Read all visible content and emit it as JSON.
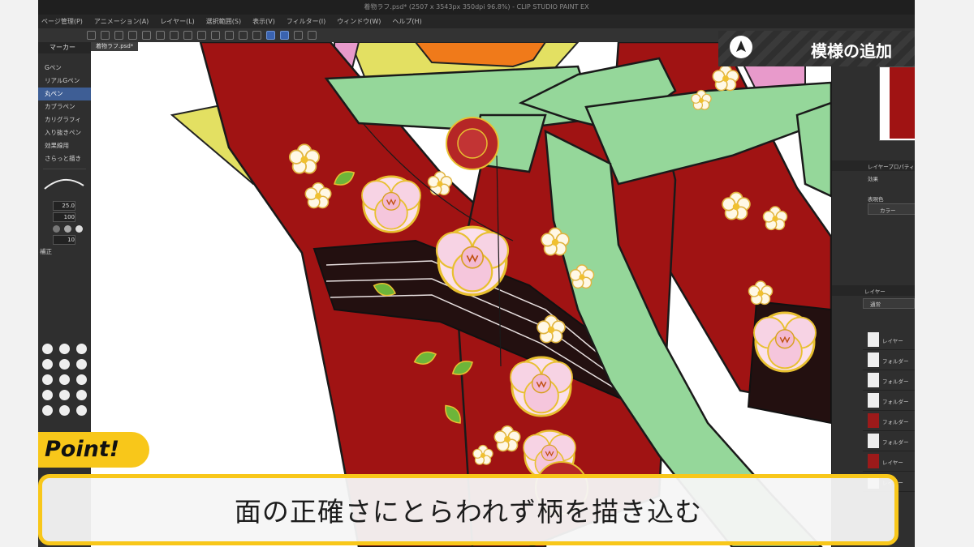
{
  "app": {
    "window_title": "着物ラフ.psd* (2507 x 3543px 350dpi 96.8%) - CLIP STUDIO PAINT EX",
    "menu": [
      "ページ管理(P)",
      "アニメーション(A)",
      "レイヤー(L)",
      "選択範囲(S)",
      "表示(V)",
      "フィルター(I)",
      "ウィンドウ(W)",
      "ヘルプ(H)"
    ],
    "doc_tab": "着物ラフ.psd*"
  },
  "left_panel": {
    "title": "マーカー",
    "subtools": [
      "Gペン",
      "リアルGペン",
      "丸ペン",
      "カブラペン",
      "カリグラフィ",
      "入り抜きペン",
      "効果線用",
      "さらっと描き"
    ],
    "selected_index": 2,
    "brush_size": "25.0",
    "opacity": "100",
    "stabilization": "10",
    "correction_label": "補正"
  },
  "right_panel": {
    "layer_property_label": "レイヤープロパティ",
    "effect_label": "効果",
    "expression_color_label": "表現色",
    "color_label": "カラー",
    "layers_label": "レイヤー",
    "blend_mode": "通常",
    "layer_rows": [
      "レイヤー",
      "フォルダー",
      "フォルダー",
      "フォルダー",
      "フォルダー",
      "フォルダー",
      "レイヤー",
      "レイヤー"
    ]
  },
  "overlay": {
    "section_title": "模様の追加",
    "point_label": "Point!",
    "caption": "面の正確さにとらわれず柄を描き込む"
  },
  "colors": {
    "accent_yellow": "#f8c71a",
    "kimono_red": "#a01313",
    "sash_green": "#95d79a"
  }
}
